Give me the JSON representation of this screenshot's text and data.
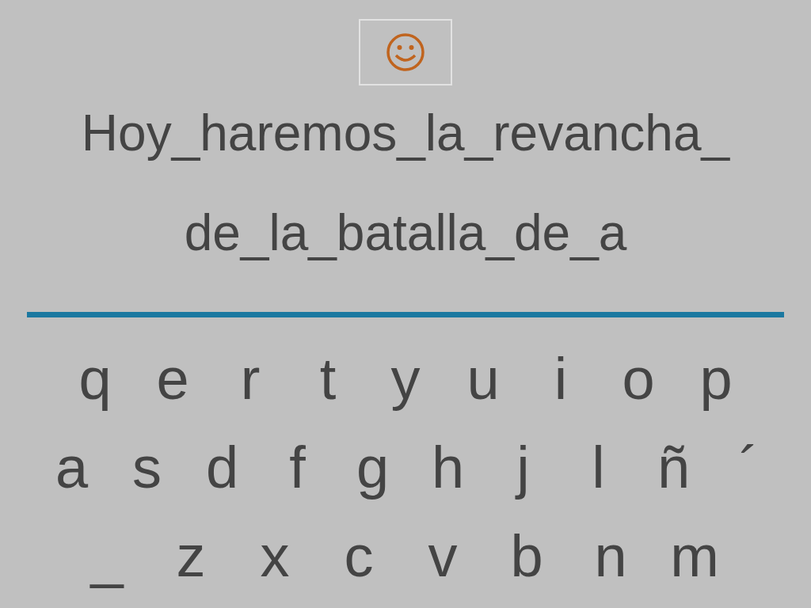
{
  "sentence_lines": [
    "Hoy_haremos_la_revancha_",
    "de_la_batalla_de_a"
  ],
  "keyboard_rows": [
    [
      "q",
      "e",
      "r",
      "t",
      "y",
      "u",
      "i",
      "o",
      "p"
    ],
    [
      "a",
      "s",
      "d",
      "f",
      "g",
      "h",
      "j",
      "l",
      "ñ",
      "´"
    ],
    [
      "_",
      "z",
      "x",
      "c",
      "v",
      "b",
      "n",
      "m"
    ]
  ]
}
